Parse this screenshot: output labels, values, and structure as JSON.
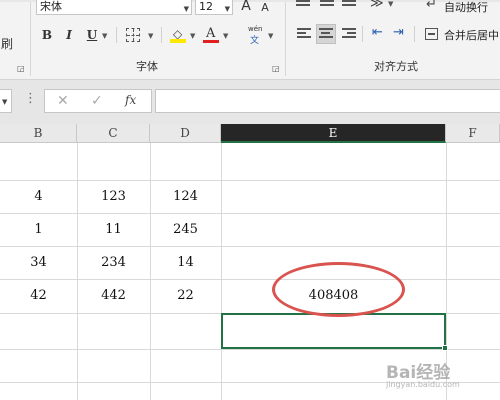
{
  "ribbon": {
    "clipboard_group": {
      "format_painter_label": "刷"
    },
    "font_group": {
      "font_name": "宋体",
      "font_size": "12",
      "grow_font_label": "A",
      "shrink_font_label": "A",
      "bold_label": "B",
      "italic_label": "I",
      "underline_label": "U",
      "font_color_label": "A",
      "phonetic_top": "wén",
      "phonetic_bottom": "文",
      "group_label": "字体"
    },
    "alignment_group": {
      "wrap_text_label": "自动换行",
      "merge_center_label": "合并后居中",
      "group_label": "对齐方式"
    }
  },
  "formula_bar": {
    "cancel_label": "✕",
    "enter_label": "✓",
    "function_label": "fx",
    "formula_value": ""
  },
  "sheet": {
    "columns": [
      {
        "id": "B",
        "label": "B",
        "selected": false
      },
      {
        "id": "C",
        "label": "C",
        "selected": false
      },
      {
        "id": "D",
        "label": "D",
        "selected": false
      },
      {
        "id": "E",
        "label": "E",
        "selected": true
      },
      {
        "id": "F",
        "label": "F",
        "selected": false
      }
    ],
    "rows": [
      {
        "B": "",
        "C": "",
        "D": "",
        "E": ""
      },
      {
        "B": "4",
        "C": "123",
        "D": "124",
        "E": ""
      },
      {
        "B": "1",
        "C": "11",
        "D": "245",
        "E": ""
      },
      {
        "B": "34",
        "C": "234",
        "D": "14",
        "E": ""
      },
      {
        "B": "42",
        "C": "442",
        "D": "22",
        "E": "408408"
      },
      {
        "B": "",
        "C": "",
        "D": "",
        "E": ""
      },
      {
        "B": "",
        "C": "",
        "D": "",
        "E": ""
      }
    ],
    "selected_cell_value": ""
  },
  "annotation": {
    "color": "#d9534f"
  },
  "colors": {
    "accent": "#217346",
    "font_color": "#e02020",
    "highlight": "#ffe800"
  },
  "watermark": {
    "text": "Bai经验",
    "url": "jingyan.baidu.com"
  }
}
